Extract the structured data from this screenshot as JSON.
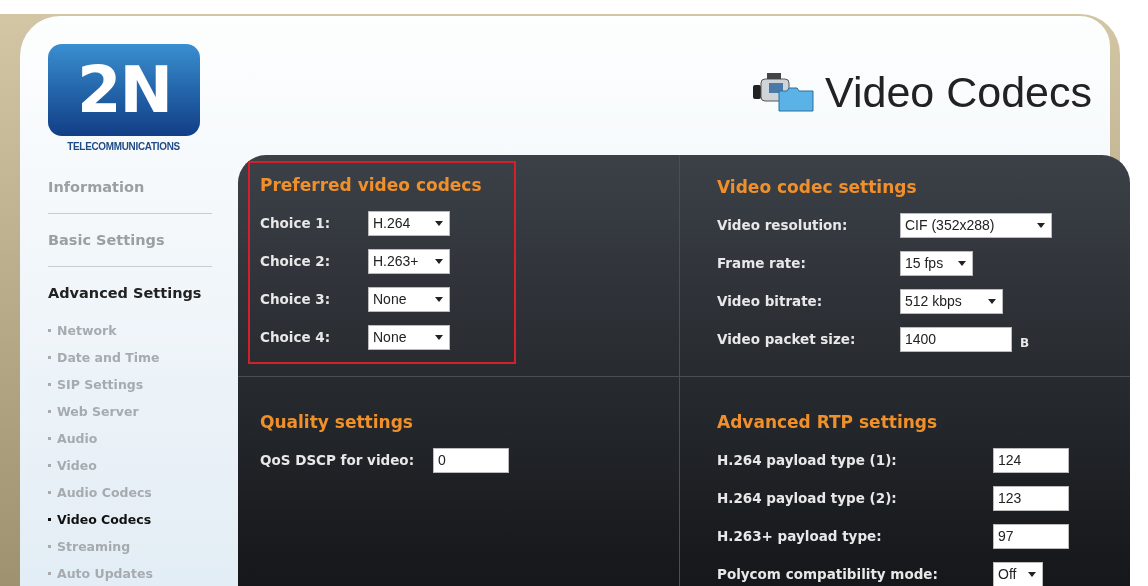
{
  "logo": {
    "mark": "2N",
    "subtitle": "TELECOMMUNICATIONS"
  },
  "page_title": "Video Codecs",
  "sidebar": {
    "sections": [
      {
        "label": "Information",
        "selected": false
      },
      {
        "label": "Basic Settings",
        "selected": false
      },
      {
        "label": "Advanced Settings",
        "selected": true,
        "children": [
          {
            "label": "Network",
            "selected": false
          },
          {
            "label": "Date and Time",
            "selected": false
          },
          {
            "label": "SIP Settings",
            "selected": false
          },
          {
            "label": "Web Server",
            "selected": false
          },
          {
            "label": "Audio",
            "selected": false
          },
          {
            "label": "Video",
            "selected": false
          },
          {
            "label": "Audio Codecs",
            "selected": false
          },
          {
            "label": "Video Codecs",
            "selected": true
          },
          {
            "label": "Streaming",
            "selected": false
          },
          {
            "label": "Auto Updates",
            "selected": false
          }
        ]
      }
    ]
  },
  "panels": [
    {
      "title": "Preferred video codecs",
      "highlighted": true,
      "fields": [
        {
          "label": "Choice 1:",
          "kind": "select",
          "value": "H.264"
        },
        {
          "label": "Choice 2:",
          "kind": "select",
          "value": "H.263+"
        },
        {
          "label": "Choice 3:",
          "kind": "select",
          "value": "None"
        },
        {
          "label": "Choice 4:",
          "kind": "select",
          "value": "None"
        }
      ]
    },
    {
      "title": "Video codec settings",
      "highlighted": false,
      "fields": [
        {
          "label": "Video resolution:",
          "kind": "select",
          "value": "CIF (352x288)"
        },
        {
          "label": "Frame rate:",
          "kind": "select",
          "value": "15 fps"
        },
        {
          "label": "Video bitrate:",
          "kind": "select",
          "value": "512 kbps"
        },
        {
          "label": "Video packet size:",
          "kind": "input",
          "value": "1400",
          "unit": "B"
        }
      ]
    },
    {
      "title": "Quality settings",
      "highlighted": false,
      "fields": [
        {
          "label": "QoS DSCP for video:",
          "kind": "input",
          "value": "0"
        }
      ]
    },
    {
      "title": "Advanced RTP settings",
      "highlighted": false,
      "fields": [
        {
          "label": "H.264 payload type (1):",
          "kind": "input",
          "value": "124"
        },
        {
          "label": "H.264 payload type (2):",
          "kind": "input",
          "value": "123"
        },
        {
          "label": "H.263+ payload type:",
          "kind": "input",
          "value": "97"
        },
        {
          "label": "Polycom compatibility mode:",
          "kind": "select",
          "value": "Off"
        }
      ]
    }
  ]
}
